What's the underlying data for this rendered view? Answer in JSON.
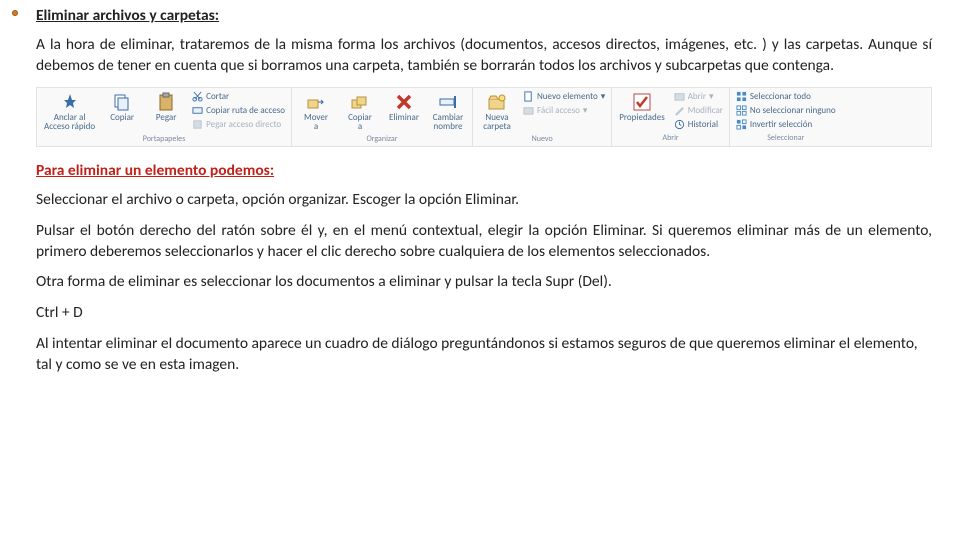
{
  "heading_main": "Eliminar archivos y carpetas:",
  "intro": "A la hora de eliminar, trataremos de la misma forma los archivos (documentos, accesos directos, imágenes, etc. ) y las carpetas. Aunque sí debemos de tener en cuenta que si borramos una carpeta, también se borrarán todos los archivos y subcarpetas que contenga.",
  "heading_sub": "Para eliminar un elemento podemos:",
  "p1": "Seleccionar el archivo o carpeta,  opción organizar.  Escoger la opción Eliminar.",
  "p2": "Pulsar el botón derecho del ratón sobre él y, en el menú contextual, elegir la opción Eliminar. Si queremos eliminar más de un elemento, primero deberemos seleccionarlos y hacer el clic derecho sobre cualquiera de los elementos seleccionados.",
  "p3": "Otra forma de eliminar es seleccionar los documentos a eliminar y pulsar la tecla Supr (Del).",
  "p4": "Ctrl + D",
  "p5": "Al intentar eliminar el documento aparece un cuadro de diálogo preguntándonos si estamos seguros de que queremos eliminar el elemento, tal y como se ve en esta imagen.",
  "ribbon": {
    "groups": {
      "portapapeles": "Portapapeles",
      "organizar": "Organizar",
      "nuevo": "Nuevo",
      "abrir": "Abrir",
      "seleccionar": "Seleccionar"
    },
    "btn": {
      "anclar1": "Anclar al",
      "anclar2": "Acceso rápido",
      "copiar": "Copiar",
      "pegar": "Pegar",
      "cortar": "Cortar",
      "copiar_ruta": "Copiar ruta de acceso",
      "pegar_acceso": "Pegar acceso directo",
      "mover1": "Mover",
      "mover2": "a",
      "copiara1": "Copiar",
      "copiara2": "a",
      "eliminar": "Eliminar",
      "cambiar1": "Cambiar",
      "cambiar2": "nombre",
      "nueva1": "Nueva",
      "nueva2": "carpeta",
      "nuevo_elemento": "Nuevo elemento",
      "facil_acceso": "Fácil acceso",
      "propiedades": "Propiedades",
      "abrir_m": "Abrir",
      "modificar": "Modificar",
      "historial": "Historial",
      "sel_todo": "Seleccionar todo",
      "sel_ninguno": "No seleccionar ninguno",
      "invertir": "Invertir selección"
    }
  }
}
